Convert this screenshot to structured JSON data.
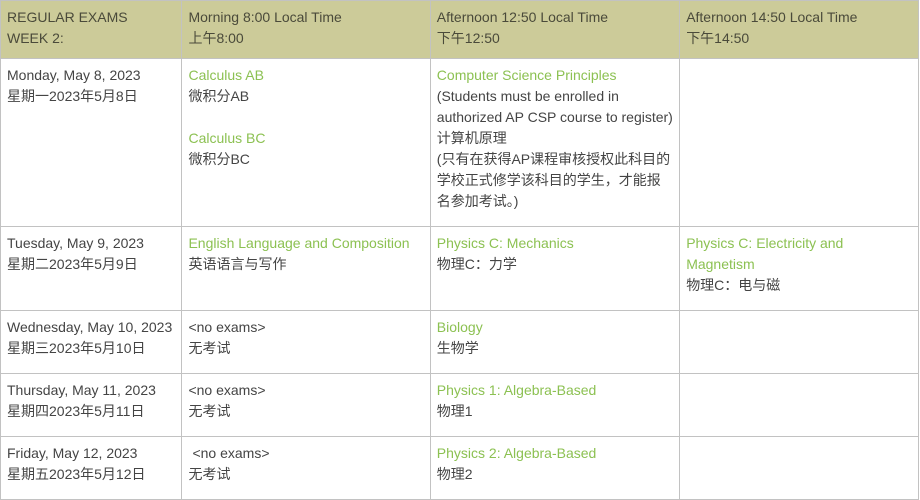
{
  "header": {
    "col0": {
      "line1": "REGULAR EXAMS",
      "line2": "WEEK 2:"
    },
    "col1": {
      "line1": "Morning 8:00 Local Time",
      "line2": "上午8:00"
    },
    "col2": {
      "line1": "Afternoon 12:50 Local Time",
      "line2": "下午12:50"
    },
    "col3": {
      "line1": "Afternoon 14:50 Local Time",
      "line2": "下午14:50"
    }
  },
  "colors": {
    "header_bg": "#cccb99",
    "exam_title": "#8cc152",
    "body_text": "#444444",
    "border": "#c2c2c2"
  },
  "rows": [
    {
      "date_en": "Monday, May 8, 2023",
      "date_cn": "星期一2023年5月8日",
      "morning": [
        {
          "title": "Calculus AB",
          "cn": "微积分AB"
        },
        {
          "title": "Calculus BC",
          "cn": "微积分BC"
        }
      ],
      "afternoon1": {
        "title": "Computer Science Principles",
        "note_en": "(Students must be enrolled in authorized AP CSP course to register)",
        "cn": "计算机原理",
        "note_cn": "(只有在获得AP课程审核授权此科目的学校正式修学该科目的学生，才能报名参加考试。)"
      },
      "afternoon2": null
    },
    {
      "date_en": "Tuesday, May 9, 2023",
      "date_cn": "星期二2023年5月9日",
      "morning": [
        {
          "title": "English Language and Composition",
          "cn": "英语语言与写作"
        }
      ],
      "afternoon1": {
        "title": "Physics C: Mechanics",
        "cn": "物理C：力学"
      },
      "afternoon2": {
        "title": "Physics C: Electricity and Magnetism",
        "cn": "物理C：电与磁"
      }
    },
    {
      "date_en": "Wednesday, May 10, 2023",
      "date_cn": "星期三2023年5月10日",
      "morning_none": {
        "en": "<no exams>",
        "cn": "无考试"
      },
      "afternoon1": {
        "title": "Biology",
        "cn": "生物学"
      },
      "afternoon2": null
    },
    {
      "date_en": "Thursday, May 11, 2023",
      "date_cn": "星期四2023年5月11日",
      "morning_none": {
        "en": "<no exams>",
        "cn": "无考试"
      },
      "afternoon1": {
        "title": "Physics 1: Algebra-Based",
        "cn": "物理1"
      },
      "afternoon2": null
    },
    {
      "date_en": "Friday, May 12, 2023",
      "date_cn": "星期五2023年5月12日",
      "morning_none": {
        "en": "<no exams>",
        "cn": "无考试"
      },
      "afternoon1": {
        "title": "Physics 2: Algebra-Based",
        "cn": "物理2"
      },
      "afternoon2": null
    }
  ]
}
